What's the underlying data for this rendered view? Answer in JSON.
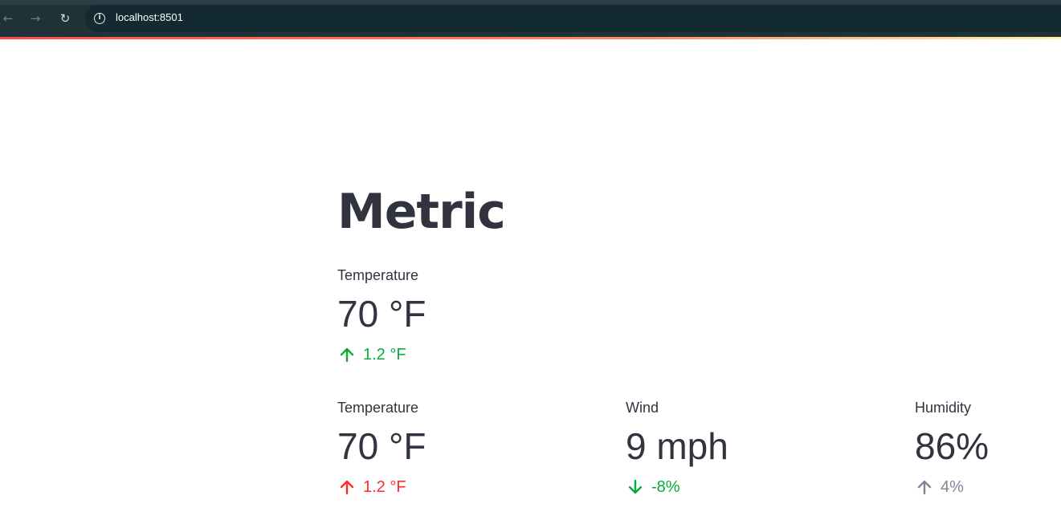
{
  "browser": {
    "url": "localhost:8501"
  },
  "page": {
    "title": "Metric"
  },
  "colors": {
    "positive": "#09ab3b",
    "negative": "#ff2b2b",
    "neutral": "#808495",
    "text": "#31333f"
  },
  "metrics": [
    {
      "label": "Temperature",
      "value": "70 °F",
      "delta": "1.2 °F",
      "direction": "up",
      "color": "#09ab3b"
    },
    {
      "label": "Temperature",
      "value": "70 °F",
      "delta": "1.2 °F",
      "direction": "up",
      "color": "#ff2b2b"
    },
    {
      "label": "Wind",
      "value": "9 mph",
      "delta": "-8%",
      "direction": "down",
      "color": "#09ab3b"
    },
    {
      "label": "Humidity",
      "value": "86%",
      "delta": "4%",
      "direction": "up",
      "color": "#808495"
    }
  ]
}
